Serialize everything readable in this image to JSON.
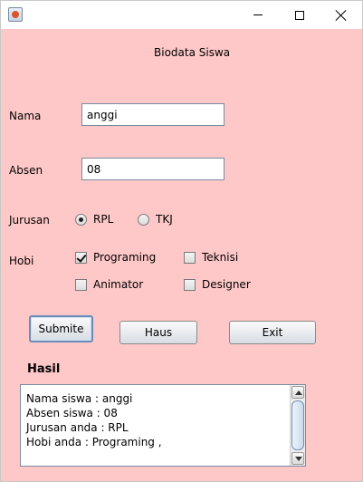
{
  "window": {
    "icon": "java-app-icon",
    "controls": {
      "minimize": "minimize-icon",
      "maximize": "maximize-icon",
      "close": "close-icon"
    }
  },
  "form": {
    "heading": "Biodata Siswa",
    "nama_label": "Nama",
    "nama_value": "anggi",
    "absen_label": "Absen",
    "absen_value": "08",
    "jurusan_label": "Jurusan",
    "jurusan_options": [
      {
        "label": "RPL",
        "selected": true
      },
      {
        "label": "TKJ",
        "selected": false
      }
    ],
    "hobi_label": "Hobi",
    "hobi_options": [
      {
        "label": "Programing",
        "checked": true
      },
      {
        "label": "Teknisi",
        "checked": false
      },
      {
        "label": "Animator",
        "checked": false
      },
      {
        "label": "Designer",
        "checked": false
      }
    ]
  },
  "buttons": {
    "submit": "Submite",
    "haus": "Haus",
    "exit": "Exit"
  },
  "result": {
    "label": "Hasil",
    "lines": [
      "Nama siswa : anggi",
      "Absen siswa : 08",
      "Jurusan anda : RPL",
      "Hobi anda : Programing ,"
    ]
  },
  "colors": {
    "background": "#ffc8c8",
    "focus_border": "#6b8cb8"
  }
}
